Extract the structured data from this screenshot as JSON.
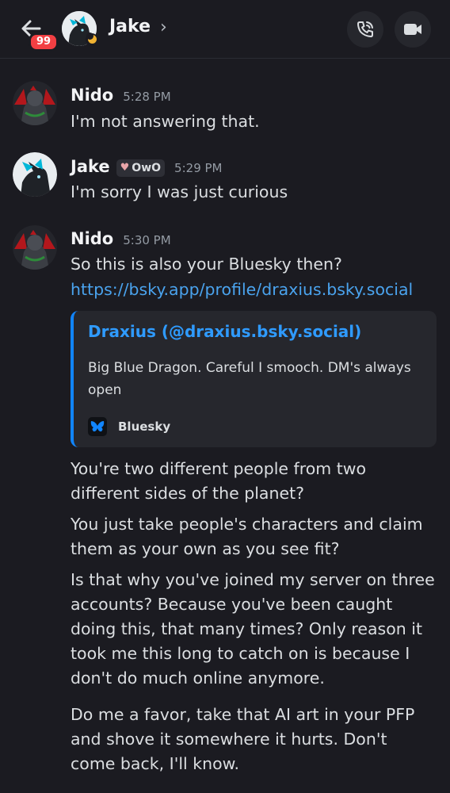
{
  "header": {
    "unread_count": "99",
    "name": "Jake",
    "chevron": "›",
    "icons": [
      "back-arrow-icon",
      "phone-call-icon",
      "video-camera-icon"
    ]
  },
  "messages": [
    {
      "author": "Nido",
      "time": "5:28 PM",
      "lines": [
        "I'm not answering that."
      ]
    },
    {
      "author": "Jake",
      "tag": "OwO",
      "time": "5:29 PM",
      "lines": [
        "I'm sorry I was just curious"
      ]
    },
    {
      "author": "Nido",
      "time": "5:30 PM",
      "lines": [
        "So this is also your Bluesky then?",
        "https://bsky.app/profile/draxius.bsky.social"
      ]
    }
  ],
  "embed": {
    "title": "Draxius (@draxius.bsky.social)",
    "description": "Big Blue Dragon. Careful I smooch. DM's always open",
    "footer": "Bluesky",
    "accent": "#1185fe"
  },
  "followups": [
    "You're two different people from two different sides of the planet?",
    "You just take people's characters and claim them as your own as you see fit?",
    "Is that why you've joined my server on three accounts? Because you've been caught doing this, that many times? Only reason it took me this long to catch on is because I don't do much online anymore.",
    "Do me a favor, take that AI art in your PFP and shove it somewhere it hurts. Don't come back, I'll know."
  ],
  "colors": {
    "background": "#1b1b21",
    "link": "#4aa3ee",
    "badge": "#f23f43",
    "idle": "#f0b232"
  }
}
